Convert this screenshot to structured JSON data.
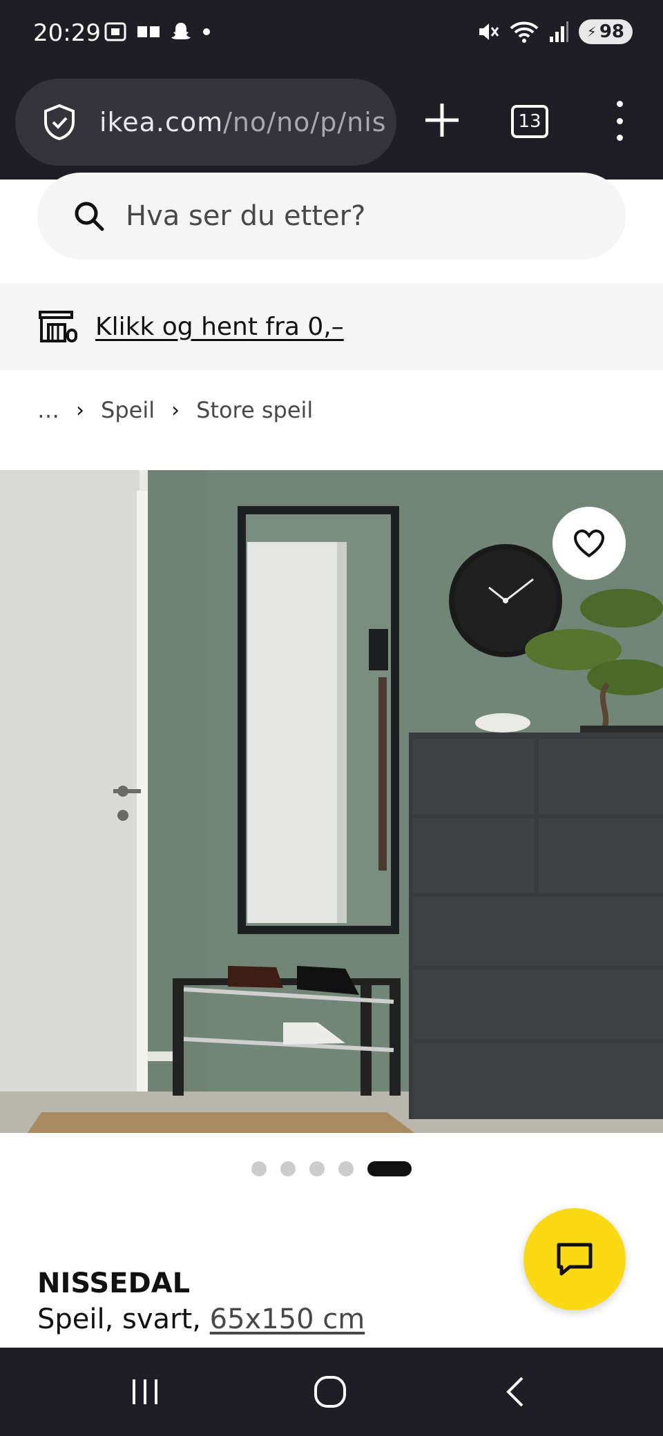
{
  "status_bar": {
    "time": "20:29",
    "battery": "98",
    "icons_left": [
      "screenshot-icon",
      "reader-icon",
      "snapchat-icon",
      "notification-dot"
    ],
    "icons_right": [
      "mute-icon",
      "wifi-icon",
      "signal-icon",
      "battery-icon"
    ]
  },
  "browser": {
    "url_host": "ikea.com",
    "url_path": "/no/no/p/nis",
    "tab_count": "13",
    "new_tab_icon": "plus-icon",
    "menu_icon": "more-vert-icon",
    "site_icon": "shield-check-icon"
  },
  "search": {
    "placeholder": "Hva ser du etter?"
  },
  "promo": {
    "text": "Klikk og hent fra 0,–",
    "icon": "store-pickup-icon"
  },
  "breadcrumb": {
    "items": [
      "…",
      "Speil",
      "Store speil"
    ]
  },
  "gallery": {
    "image_alt": "NISSEDAL speil i gang med klokke, kommode og skohylle",
    "dot_count": 5,
    "active_index": 4
  },
  "product": {
    "name": "NISSEDAL",
    "description_prefix": "Speil, svart, ",
    "size": "65x150 cm"
  },
  "colors": {
    "chrome": "#1f1e24",
    "accent_yellow": "#fbd914",
    "wall_green": "#6e8273",
    "text": "#111111"
  }
}
